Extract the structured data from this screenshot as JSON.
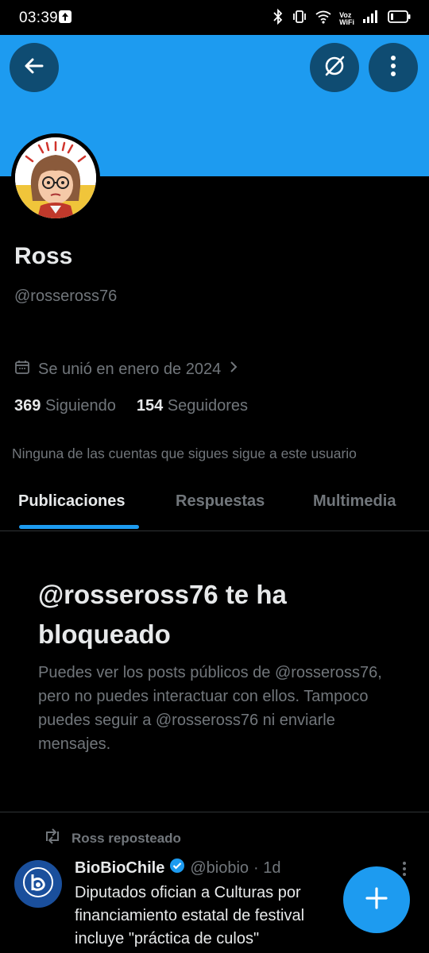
{
  "status_bar": {
    "time": "03:39",
    "voz_label": "Voz",
    "wifi_label": "WiFi"
  },
  "profile": {
    "name": "Ross",
    "handle": "@rosseross76",
    "joined": "Se unió en enero de 2024",
    "following_count": "369",
    "following_label": "Siguiendo",
    "followers_count": "154",
    "followers_label": "Seguidores",
    "mutuals_note": "Ninguna de las cuentas que sigues sigue a este usuario"
  },
  "tabs": [
    {
      "label": "Publicaciones",
      "active": true
    },
    {
      "label": "Respuestas",
      "active": false
    },
    {
      "label": "Multimedia",
      "active": false
    }
  ],
  "blocked": {
    "title": "@rosseross76 te ha bloqueado",
    "body": "Puedes ver los posts públicos de @rosseross76, pero no puedes interactuar con ellos. Tampoco puedes seguir a @rosseross76 ni enviarle mensajes."
  },
  "post": {
    "repost_label": "Ross reposteado",
    "author_name": "BioBioChile",
    "author_handle": "@biobio",
    "time": "· 1d",
    "text_lines": [
      "Diputados ofician a Culturas por",
      "financiamiento estatal de festival",
      "incluye \"práctica de culos\""
    ]
  },
  "colors": {
    "accent": "#1d9bf0",
    "banner": "#1d9bf0",
    "background": "#000000",
    "secondary_text": "#71767b"
  },
  "icons": [
    "back-arrow-icon",
    "search-off-icon",
    "more-vertical-icon",
    "calendar-icon",
    "chevron-right-icon",
    "repost-icon",
    "verified-icon",
    "plus-icon"
  ]
}
